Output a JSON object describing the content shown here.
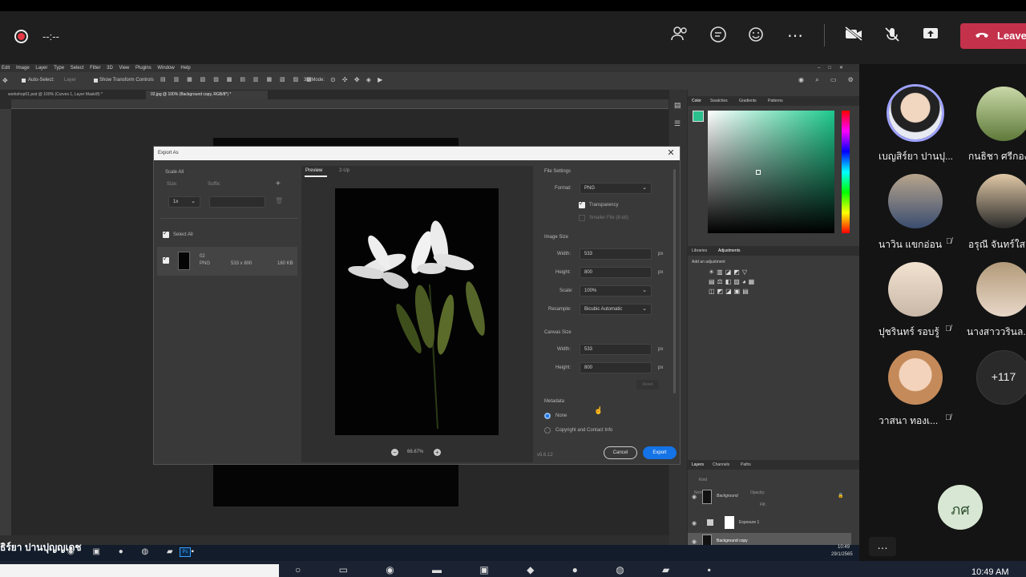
{
  "teams": {
    "timer": "--:--",
    "leave_label": "Leave",
    "extra_count": "+117",
    "initials_avatar": "ภศ",
    "more_label": "…",
    "participants": [
      {
        "name": "เบญสิร์ยา ปานปุ..."
      },
      {
        "name": "กนธิชา ศรีกอง"
      },
      {
        "name": "นาวิน แขกอ่อน",
        "muted": true
      },
      {
        "name": "อรุณี จันทร์ใส"
      },
      {
        "name": "ปุชรินทร์ รอบรู้",
        "muted": true
      },
      {
        "name": "นางสาววรินล..."
      },
      {
        "name": "วาสนา ทองเ...",
        "muted": true
      }
    ],
    "presenter_label": "ธิร์ยา ปานปุญญเดช"
  },
  "photoshop": {
    "menu": [
      "Edit",
      "Image",
      "Layer",
      "Type",
      "Select",
      "Filter",
      "3D",
      "View",
      "Plugins",
      "Window",
      "Help"
    ],
    "options": {
      "auto_select": "Auto-Select:",
      "layer": "Layer",
      "show_transform": "Show Transform Controls",
      "mode_3d": "3D Mode:"
    },
    "tabs": [
      {
        "label": "workshop01.psd @ 100% (Curves 1, Layer Mask/8) *"
      },
      {
        "label": "02.jpg @ 100% (Background copy, RGB/8*) *"
      }
    ],
    "color_tabs": [
      "Color",
      "Swatches",
      "Gradients",
      "Patterns"
    ],
    "adj_tabs": [
      "Libraries",
      "Adjustments"
    ],
    "adj_hint": "Add an adjustment",
    "layer_tabs": [
      "Layers",
      "Channels",
      "Paths"
    ],
    "layer_kind": "Kind",
    "layer_blend": "Normal",
    "layer_opacity": "Opacity:",
    "layer_fill": "Fill:",
    "layers": [
      "Exposure 1",
      "Background copy",
      "Background"
    ],
    "clock_time": "10:49",
    "clock_date": "29/1/2565"
  },
  "dialog": {
    "title": "Export As",
    "scale_all": "Scale All",
    "size_label": "Size:",
    "suffix_label": "Suffix:",
    "scale_value": "1x",
    "select_all": "Select All",
    "asset": {
      "name": "02",
      "format": "PNG",
      "dims": "533 x 800",
      "size": "180 KB"
    },
    "preview_tab": "Preview",
    "twoup_tab": "2-Up",
    "zoom": "66.67%",
    "file_settings": "File Settings",
    "format_label": "Format:",
    "format_value": "PNG",
    "transparency": "Transparency",
    "smaller_file": "Smaller File (8-bit)",
    "image_size": "Image Size",
    "width_label": "Width:",
    "height_label": "Height:",
    "scale_label": "Scale:",
    "resample_label": "Resample:",
    "img_width": "533",
    "img_height": "800",
    "scale_pct": "100%",
    "resample_value": "Bicubic Automatic",
    "canvas_size": "Canvas Size",
    "canvas_width": "533",
    "canvas_height": "800",
    "reset": "Reset",
    "unit": "px",
    "metadata": "Metadata",
    "meta_none": "None",
    "meta_copyright": "Copyright and Contact Info",
    "version": "v5.6.12",
    "cancel": "Cancel",
    "export": "Export"
  },
  "taskbar": {
    "time": "10:49 AM"
  },
  "colors": {
    "accent": "#1473e6",
    "leave": "#c4314b",
    "teams_bg": "#1f1f1f"
  }
}
